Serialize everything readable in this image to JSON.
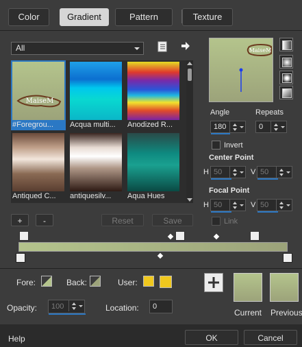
{
  "tabs": [
    {
      "label": "Color"
    },
    {
      "label": "Gradient"
    },
    {
      "label": "Pattern"
    },
    {
      "label": "Texture"
    }
  ],
  "active_tab": "Gradient",
  "category_select": {
    "value": "All"
  },
  "gradients": [
    {
      "label": "#Foregrou...",
      "selected": true
    },
    {
      "label": "Acqua multi..."
    },
    {
      "label": "Anodized R..."
    },
    {
      "label": "Antiqued C..."
    },
    {
      "label": "antiquesilv..."
    },
    {
      "label": "Aqua Hues"
    }
  ],
  "watermark_text": "MaiseM",
  "buttons": {
    "add": "+",
    "remove": "-",
    "reset": "Reset",
    "save": "Save",
    "ok": "OK",
    "cancel": "Cancel",
    "help": "Help"
  },
  "angle": {
    "label": "Angle",
    "value": "180"
  },
  "repeats": {
    "label": "Repeats",
    "value": "0"
  },
  "invert": {
    "label": "Invert"
  },
  "center_point": {
    "label": "Center Point",
    "h_label": "H",
    "h_value": "50",
    "v_label": "V",
    "v_value": "50"
  },
  "focal_point": {
    "label": "Focal Point",
    "h_label": "H",
    "h_value": "50",
    "v_label": "V",
    "v_value": "50"
  },
  "link": {
    "label": "Link"
  },
  "fore": {
    "label": "Fore:"
  },
  "back": {
    "label": "Back:"
  },
  "user": {
    "label": "User:"
  },
  "opacity": {
    "label": "Opacity:",
    "value": "100"
  },
  "location": {
    "label": "Location:",
    "value": "0"
  },
  "current": {
    "label": "Current"
  },
  "previous": {
    "label": "Previous"
  },
  "colors": {
    "gradient_start": "#b4c48c",
    "gradient_end": "#9ca37a",
    "user_color": "#f0c81e",
    "accent": "#2b78c4"
  }
}
